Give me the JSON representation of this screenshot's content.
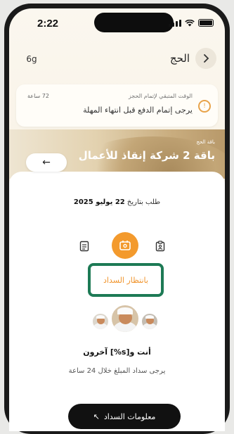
{
  "status_bar": {
    "time": "2:22"
  },
  "header": {
    "title": "الحج",
    "back_icon": "chevron-right-icon",
    "lang_icon": "language-icon",
    "lang_label": "6g"
  },
  "deadline": {
    "label": "الوقت المتبقي لإتمام الحجز",
    "message": "يرجى إتمام الدفع قبل انتهاء المهلة",
    "hours": "72 ساعة",
    "accent": "#e8a34a"
  },
  "banner": {
    "subtitle": "باقة الحج",
    "title": "باقة 2 شركة إنقاذ للأعمال",
    "button_icon": "arrow-left-icon",
    "button_symbol": "←"
  },
  "order": {
    "prefix": "طلب بتاريخ",
    "date": "22 يوليو 2025"
  },
  "steps": {
    "active_color": "#f39a2d"
  },
  "status": {
    "text": "بانتظار السداد",
    "color": "#f0932a",
    "highlight": "#1d7a55"
  },
  "people": {
    "text": "أنت و[s%] آخرون"
  },
  "payment_note": "يرجى سداد المبلغ خلال 24 ساعة",
  "pay_button": {
    "label": "معلومات السداد",
    "icon": "arrow-up-left-icon",
    "symbol": "↖"
  }
}
